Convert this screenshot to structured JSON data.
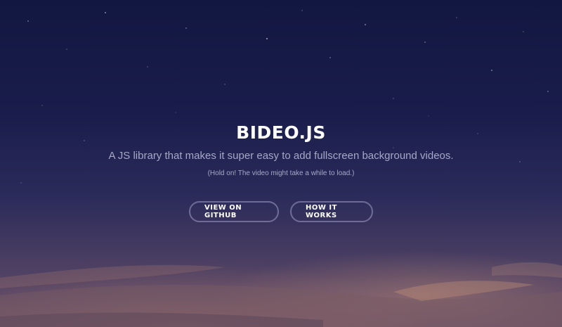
{
  "hero": {
    "title": "BIDEO.JS",
    "subtitle": "A JS library that makes it super easy to add fullscreen background videos.",
    "note": "(Hold on! The video might take a while to load.)"
  },
  "buttons": {
    "github_label": "VIEW ON GITHUB",
    "how_label": "HOW IT WORKS"
  },
  "colors": {
    "sky_top": "#121741",
    "sky_bottom": "#6b5168",
    "text_muted": "#a6a8c8"
  }
}
